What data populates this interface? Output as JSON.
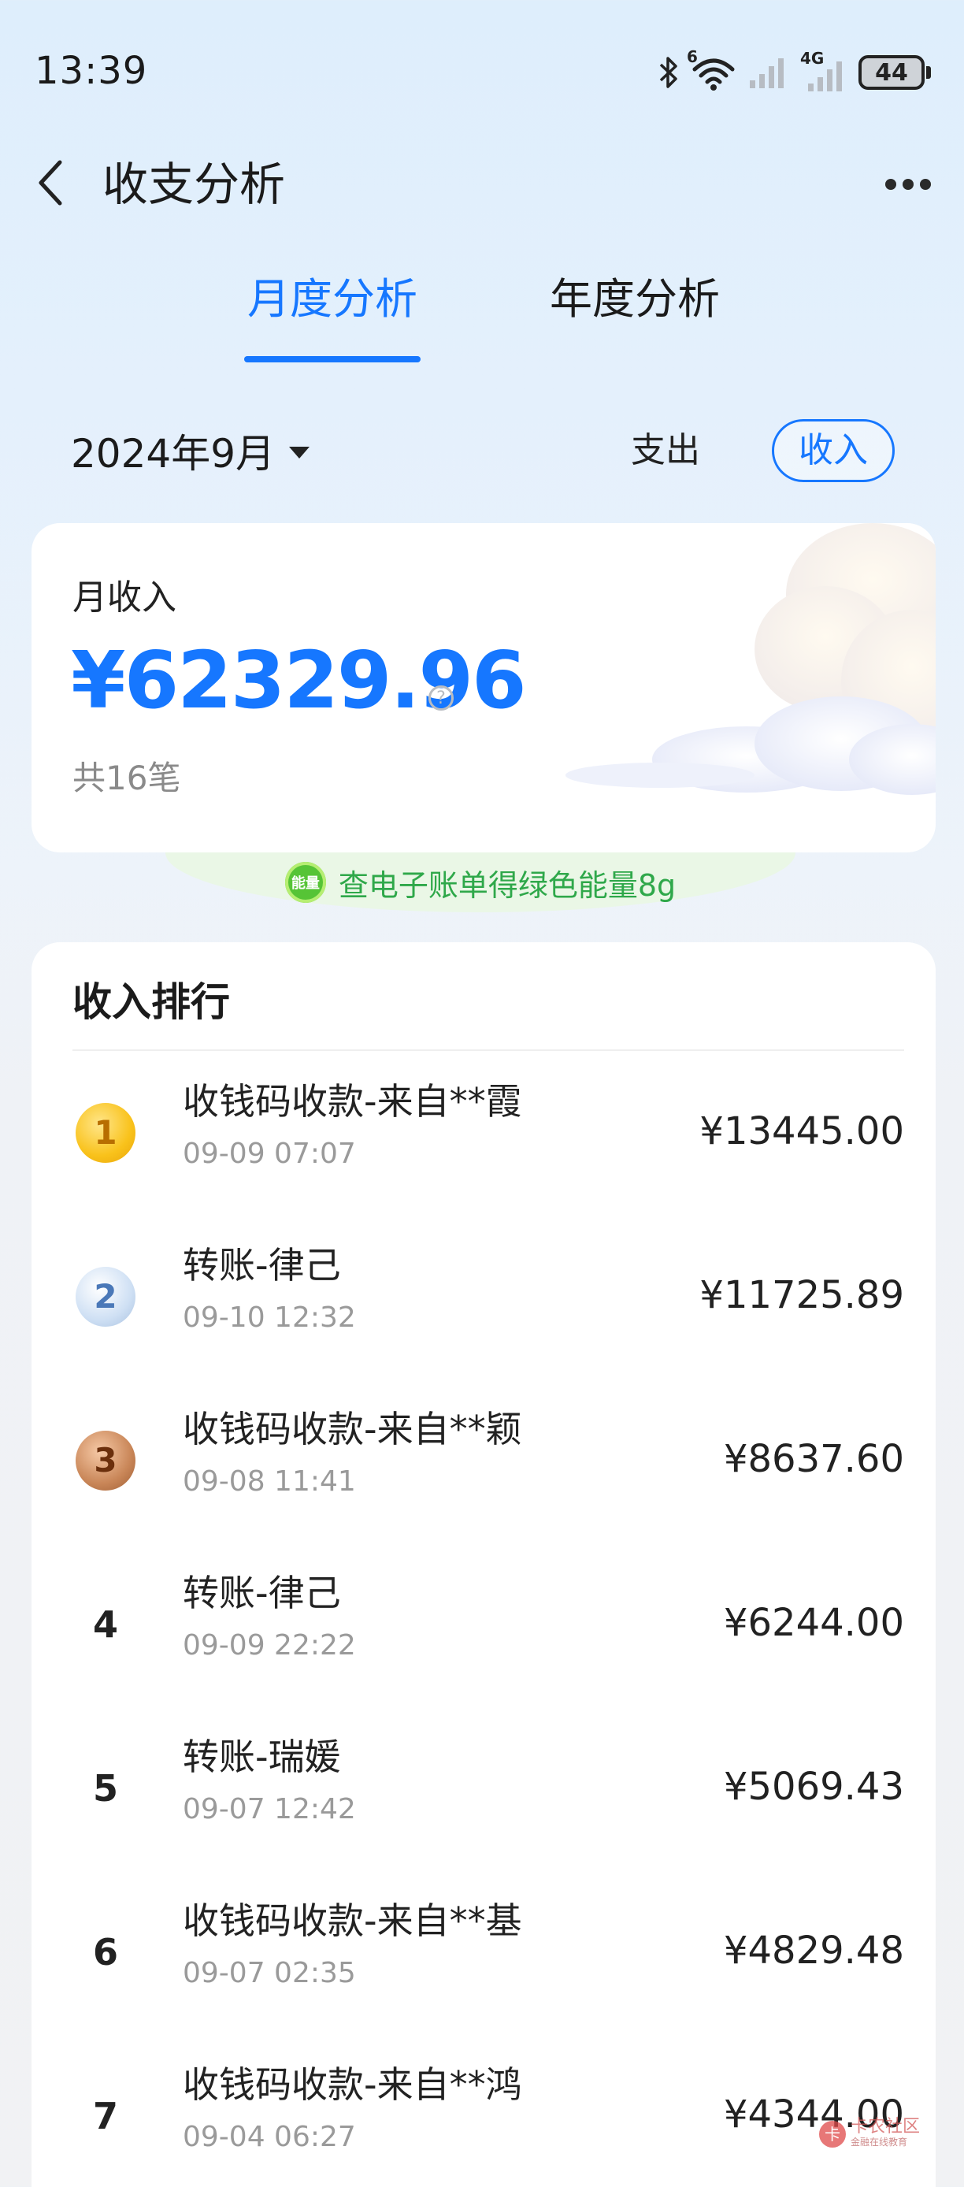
{
  "status_bar": {
    "time": "13:39",
    "wifi_label": "6",
    "network_label": "4G",
    "battery": "44",
    "icons": [
      "bluetooth-icon",
      "wifi-icon",
      "signal-icon",
      "signal-4g-icon",
      "battery-icon"
    ]
  },
  "header": {
    "title": "收支分析",
    "back_icon": "chevron-left-icon",
    "more_icon": "more-dots-icon"
  },
  "tabs": [
    {
      "label": "月度分析",
      "active": true
    },
    {
      "label": "年度分析",
      "active": false
    }
  ],
  "filter": {
    "month": "2024年9月",
    "expense_label": "支出",
    "income_label": "收入",
    "selected": "收入"
  },
  "summary": {
    "label": "月收入",
    "amount": "¥62329.96",
    "info_icon": "?",
    "count": "共16笔"
  },
  "energy_banner": {
    "badge": "能量",
    "text": "查电子账单得绿色能量8g"
  },
  "ranking": {
    "title": "收入排行",
    "items": [
      {
        "rank": "1",
        "name": "收钱码收款-来自**霞",
        "time": "09-09 07:07",
        "amount": "¥13445.00"
      },
      {
        "rank": "2",
        "name": "转账-律己",
        "time": "09-10 12:32",
        "amount": "¥11725.89"
      },
      {
        "rank": "3",
        "name": "收钱码收款-来自**颖",
        "time": "09-08 11:41",
        "amount": "¥8637.60"
      },
      {
        "rank": "4",
        "name": "转账-律己",
        "time": "09-09 22:22",
        "amount": "¥6244.00"
      },
      {
        "rank": "5",
        "name": "转账-瑞媛",
        "time": "09-07 12:42",
        "amount": "¥5069.43"
      },
      {
        "rank": "6",
        "name": "收钱码收款-来自**基",
        "time": "09-07 02:35",
        "amount": "¥4829.48"
      },
      {
        "rank": "7",
        "name": "收钱码收款-来自**鸿",
        "time": "09-04 06:27",
        "amount": "¥4344.00"
      }
    ]
  },
  "watermark": {
    "text": "卡农社区",
    "sub": "金融在线教育",
    "logo": "卡"
  },
  "colors": {
    "accent": "#1677ff",
    "energy_green": "#2fa84a",
    "muted_text": "#9a9a9a",
    "background_top": "#deeefc"
  }
}
